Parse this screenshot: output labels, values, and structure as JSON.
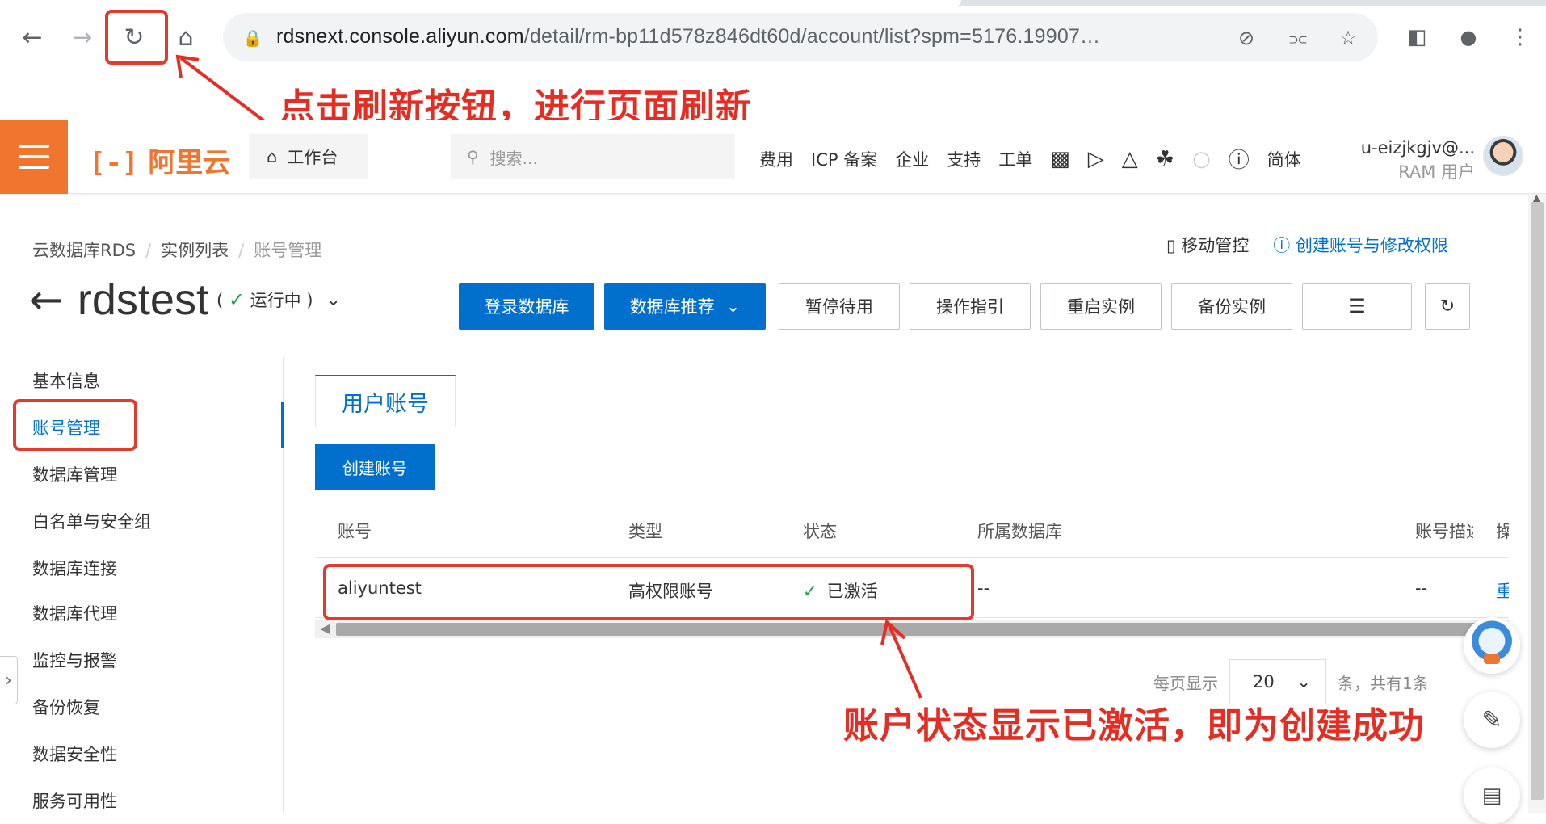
{
  "browser": {
    "url_host": "rdsnext.console.aliyun.com",
    "url_path": "/detail/rm-bp11d578z846dt60d/account/list?spm=5176.19907…"
  },
  "annotations": {
    "refresh_note": "点击刷新按钮，进行页面刷新",
    "status_note": "账户状态显示已激活，即为创建成功"
  },
  "topbar": {
    "logo": "阿里云",
    "workbench": "工作台",
    "search_placeholder": "搜索...",
    "nav": [
      "费用",
      "ICP 备案",
      "企业",
      "支持",
      "工单"
    ],
    "lang": "简体",
    "user_name": "u-eizjkgjv@...",
    "user_type": "RAM 用户"
  },
  "breadcrumb": [
    "云数据库RDS",
    "实例列表",
    "账号管理"
  ],
  "right_links": {
    "mobile": "移动管控",
    "help": "创建账号与修改权限"
  },
  "instance": {
    "name": "rdstest",
    "status_open": "(",
    "status": "运行中",
    "status_close": ")"
  },
  "actions": {
    "login": "登录数据库",
    "recommend": "数据库推荐",
    "pause": "暂停待用",
    "guide": "操作指引",
    "restart": "重启实例",
    "backup": "备份实例"
  },
  "sidebar": {
    "items": [
      "基本信息",
      "账号管理",
      "数据库管理",
      "白名单与安全组",
      "数据库连接",
      "数据库代理",
      "监控与报警",
      "备份恢复",
      "数据安全性",
      "服务可用性"
    ]
  },
  "tabs": {
    "user_accounts": "用户账号"
  },
  "create_account": "创建账号",
  "table": {
    "headers": {
      "account": "账号",
      "type": "类型",
      "status": "状态",
      "db": "所属数据库",
      "desc": "账号描述",
      "op": "操"
    },
    "rows": [
      {
        "account": "aliyuntest",
        "type": "高权限账号",
        "status": "已激活",
        "db": "--",
        "desc": "--",
        "op": "重"
      }
    ]
  },
  "pagination": {
    "per_page_label": "每页显示",
    "per_page": "20",
    "total": "条，共有1条"
  },
  "colors": {
    "accent": "#0070cc",
    "brand": "#f0762f",
    "annotation": "#e52e23",
    "success": "#1aa34a"
  }
}
